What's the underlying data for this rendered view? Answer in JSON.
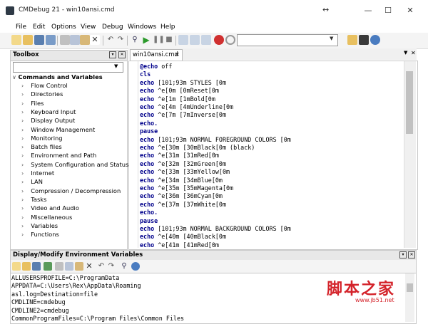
{
  "window": {
    "title": "CMDebug 21 - win10ansi.cmd"
  },
  "menu": [
    "File",
    "Edit",
    "Options",
    "View",
    "Debug",
    "Windows",
    "Help"
  ],
  "toolbox": {
    "title": "Toolbox",
    "filter_value": "",
    "root": "Commands and Variables",
    "items": [
      "Flow Control",
      "Directories",
      "Files",
      "Keyboard Input",
      "Display Output",
      "Window Management",
      "Monitoring",
      "Batch files",
      "Environment and Path",
      "System Configuration and Status",
      "Internet",
      "LAN",
      "Compression / Decompression",
      "Tasks",
      "Video and Audio",
      "Miscellaneous",
      "Variables",
      "Functions"
    ]
  },
  "editor": {
    "tab": "win10ansi.cmd",
    "lines": [
      {
        "kw": "@echo",
        "rest": " off"
      },
      {
        "kw": "cls",
        "rest": ""
      },
      {
        "kw": "echo",
        "rest": " [101;93m STYLES [0m"
      },
      {
        "kw": "echo",
        "rest": " ^e[0m [0mReset[0m"
      },
      {
        "kw": "echo",
        "rest": " ^e[1m [1mBold[0m"
      },
      {
        "kw": "echo",
        "rest": " ^e[4m [4mUnderline[0m"
      },
      {
        "kw": "echo",
        "rest": " ^e[7m [7mInverse[0m"
      },
      {
        "kw": "echo.",
        "rest": ""
      },
      {
        "kw": "pause",
        "rest": ""
      },
      {
        "kw": "echo",
        "rest": " [101;93m NORMAL FOREGROUND COLORS [0m"
      },
      {
        "kw": "echo",
        "rest": " ^e[30m [30mBlack[0m (black)"
      },
      {
        "kw": "echo",
        "rest": " ^e[31m [31mRed[0m"
      },
      {
        "kw": "echo",
        "rest": " ^e[32m [32mGreen[0m"
      },
      {
        "kw": "echo",
        "rest": " ^e[33m [33mYellow[0m"
      },
      {
        "kw": "echo",
        "rest": " ^e[34m [34mBlue[0m"
      },
      {
        "kw": "echo",
        "rest": " ^e[35m [35mMagenta[0m"
      },
      {
        "kw": "echo",
        "rest": " ^e[36m [36mCyan[0m"
      },
      {
        "kw": "echo",
        "rest": " ^e[37m [37mWhite[0m"
      },
      {
        "kw": "echo.",
        "rest": ""
      },
      {
        "kw": "pause",
        "rest": ""
      },
      {
        "kw": "echo",
        "rest": " [101;93m NORMAL BACKGROUND COLORS [0m"
      },
      {
        "kw": "echo",
        "rest": " ^e[40m [40mBlack[0m"
      },
      {
        "kw": "echo",
        "rest": " ^e[41m [41mRed[0m"
      }
    ]
  },
  "env": {
    "title": "Display/Modify Environment Variables",
    "lines": [
      "ALLUSERSPROFILE=C:\\ProgramData",
      "APPDATA=C:\\Users\\Rex\\AppData\\Roaming",
      "asl.log=Destination=file",
      "CMDLINE=cmdebug",
      "CMDLINE2=cmdebug",
      "CommonProgramFiles=C:\\Program Files\\Common Files"
    ]
  },
  "watermark": {
    "logo": "脚本之家",
    "url": "www.jb51.net"
  },
  "colors": {
    "keyword": "#00008b",
    "record": "#d03030",
    "run": "#2c9a2c",
    "watermark": "#d4232a"
  }
}
